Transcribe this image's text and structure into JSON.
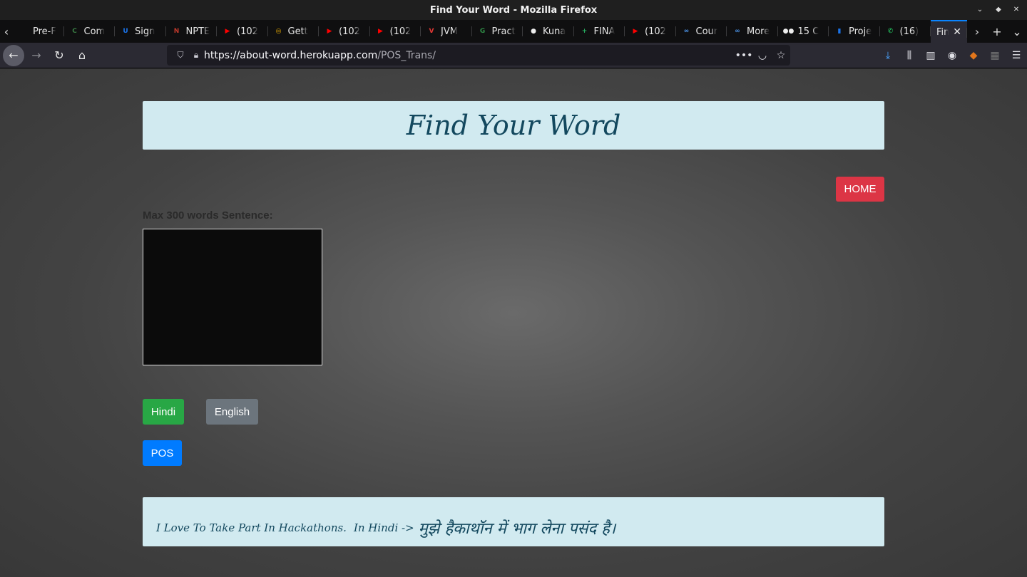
{
  "window": {
    "title": "Find Your Word - Mozilla Firefox"
  },
  "tabs": [
    {
      "label": "Pre-F",
      "icon": "blank-page-icon",
      "color": "#444444"
    },
    {
      "label": "Com",
      "icon": "codechef-icon",
      "color": "#3a7d44"
    },
    {
      "label": "Sign",
      "icon": "udemy-icon",
      "color": "#1a73e8"
    },
    {
      "label": "NPTE",
      "icon": "nptel-icon",
      "color": "#c0392b"
    },
    {
      "label": "(102",
      "icon": "youtube-icon",
      "color": "#ff0000"
    },
    {
      "label": "Gett",
      "icon": "getting-started-icon",
      "color": "#f4b400"
    },
    {
      "label": "(102",
      "icon": "youtube-icon",
      "color": "#ff0000"
    },
    {
      "label": "(102",
      "icon": "youtube-icon",
      "color": "#ff0000"
    },
    {
      "label": "JVM",
      "icon": "v-logo-icon",
      "color": "#e53935"
    },
    {
      "label": "Pract",
      "icon": "geeksforgeeks-icon",
      "color": "#2f8d46"
    },
    {
      "label": "Kuna",
      "icon": "github-icon",
      "color": "#eeeeee"
    },
    {
      "label": "FINA",
      "icon": "sheets-plus-icon",
      "color": "#27ae60"
    },
    {
      "label": "(102",
      "icon": "youtube-icon",
      "color": "#ff0000"
    },
    {
      "label": "Cour",
      "icon": "infinity-icon",
      "color": "#4a90e2"
    },
    {
      "label": "More",
      "icon": "infinity-icon",
      "color": "#4a90e2"
    },
    {
      "label": "15 C",
      "icon": "medium-icon",
      "color": "#eeeeee"
    },
    {
      "label": "Proje",
      "icon": "docs-icon",
      "color": "#1a73e8"
    },
    {
      "label": "(16)",
      "icon": "whatsapp-icon",
      "color": "#25d366"
    }
  ],
  "active_tab": {
    "label": "Find Y"
  },
  "url": {
    "host": "https://about-word.herokuapp.com",
    "path": "/POS_Trans/"
  },
  "page": {
    "heading": "Find Your Word",
    "home_button": "HOME",
    "input_label": "Max 300 words Sentence:",
    "input_value": "",
    "hindi_button": "Hindi",
    "english_button": "English",
    "pos_button": "POS",
    "result": {
      "english": "I Love To Take Part In Hackathons.",
      "hindi_prefix": "In Hindi ->",
      "hindi": "मुझे हैकाथॉन में भाग लेना पसंद है।"
    }
  },
  "colors": {
    "home": "#dc3545",
    "hindi": "#28a745",
    "english": "#6c757d",
    "pos": "#007bff",
    "panel": "#d1eaf0",
    "panel_text": "#13485e"
  }
}
